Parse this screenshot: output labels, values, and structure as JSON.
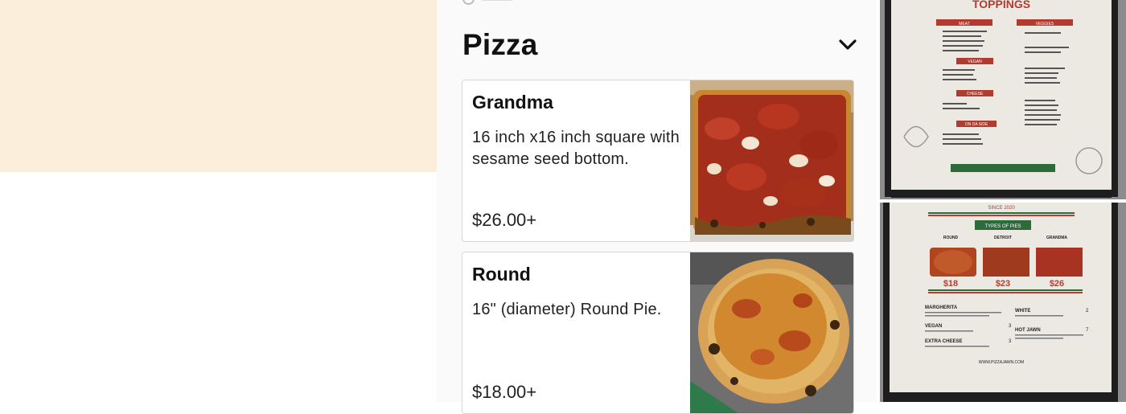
{
  "section": {
    "title": "Pizza",
    "expand_icon": "chevron-down-icon"
  },
  "items": [
    {
      "name": "Grandma",
      "description": "16 inch x16 inch square with sesame seed bottom.",
      "price": "$26.00+"
    },
    {
      "name": "Round",
      "description": "16\" (diameter) Round Pie.",
      "price": "$18.00+"
    }
  ],
  "menu_photo_toppings": {
    "heading": "TOPPINGS",
    "meat_label": "MEAT",
    "veggies_label": "VEGGIES",
    "vegan_label": "VEGAN",
    "cheese_label": "CHEESE",
    "on_da_side_label": "ON DA SIDE"
  },
  "menu_photo_pies": {
    "since": "SINCE 2020",
    "heading": "TYPES OF PIES",
    "col_round": "ROUND",
    "col_detroit": "DETROIT",
    "col_grandma": "GRANDMA",
    "price_round": "$18",
    "price_detroit": "$23",
    "price_grandma": "$26",
    "margherita": "MARGHERITA",
    "vegan": "VEGAN",
    "extra_cheese": "EXTRA CHEESE",
    "white": "WHITE",
    "hot_jawn": "HOT JAWN",
    "white_price": "2",
    "vegan_price": "3",
    "hot_jawn_price": "7",
    "extra_cheese_price": "3",
    "website": "WWW.PIZZAJAWN.COM"
  },
  "colors": {
    "cream": "#fbefdb",
    "menu_bg": "#fafafa",
    "accent_red": "#c0392b",
    "accent_green": "#2e6b3a"
  }
}
